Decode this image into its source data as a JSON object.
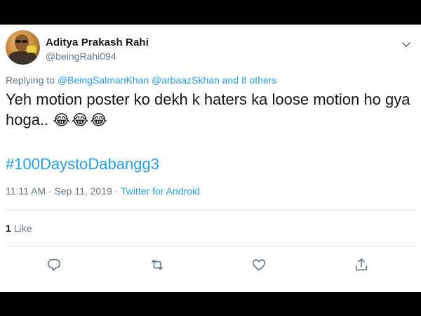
{
  "user": {
    "name": "Aditya Prakash Rahi",
    "handle": "@beingRahi094"
  },
  "reply": {
    "prefix": "Replying to",
    "mention1": "@BeingSalmanKhan",
    "mention2": "@arbaazSkhan",
    "others": "and 8 others"
  },
  "tweet": {
    "text": "Yeh motion poster ko dekh k haters ka loose motion ho gya hoga..",
    "emojis": "😂😂😂",
    "hashtag": "#100DaystoDabangg3"
  },
  "meta": {
    "time": "11:11 AM",
    "sep1": "·",
    "date": "Sep 11, 2019",
    "sep2": "·",
    "source": "Twitter for Android"
  },
  "stats": {
    "like_count": "1",
    "like_label": "Like"
  },
  "icons": {
    "reply": "reply-icon",
    "retweet": "retweet-icon",
    "like": "heart-icon",
    "share": "share-icon",
    "menu": "chevron-down-icon"
  },
  "colors": {
    "link": "#1da1f2",
    "muted": "#657786",
    "text": "#14171a"
  }
}
